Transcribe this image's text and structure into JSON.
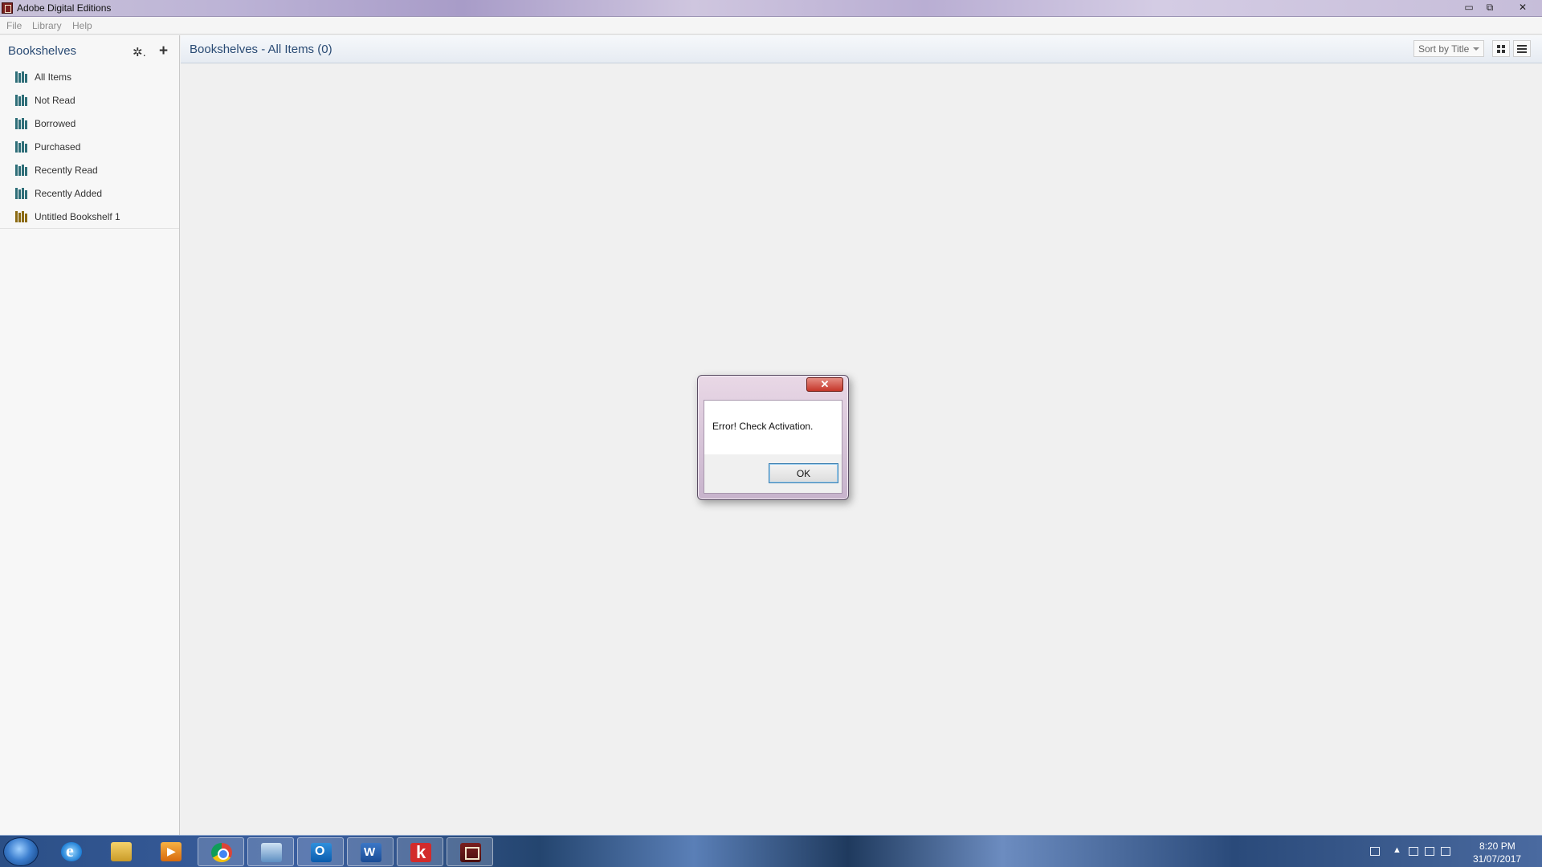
{
  "window": {
    "title": "Adobe Digital Editions"
  },
  "window_controls": {
    "minimize": "▭",
    "maximize": "⧉",
    "close": "✕"
  },
  "menu": [
    "File",
    "Library",
    "Help"
  ],
  "sidebar": {
    "title": "Bookshelves",
    "gear_glyph": "✲.",
    "add_glyph": "+",
    "items": [
      {
        "label": "All Items",
        "icon": "bookshelf-icon"
      },
      {
        "label": "Not Read",
        "icon": "bookshelf-icon"
      },
      {
        "label": "Borrowed",
        "icon": "bookshelf-icon"
      },
      {
        "label": "Purchased",
        "icon": "bookshelf-icon"
      },
      {
        "label": "Recently Read",
        "icon": "bookshelf-icon"
      },
      {
        "label": "Recently Added",
        "icon": "bookshelf-icon"
      },
      {
        "label": "Untitled Bookshelf 1",
        "icon": "custom-bookshelf-icon"
      }
    ]
  },
  "content": {
    "title": "Bookshelves - All Items (0)",
    "sort_label": "Sort by Title"
  },
  "dialog": {
    "close_glyph": "✕",
    "message": "Error! Check Activation.",
    "ok_label": "OK"
  },
  "taskbar": {
    "apps": [
      {
        "name": "internet-explorer-icon"
      },
      {
        "name": "file-explorer-icon"
      },
      {
        "name": "media-player-icon"
      },
      {
        "name": "chrome-icon"
      },
      {
        "name": "remote-desktop-icon"
      },
      {
        "name": "outlook-icon"
      },
      {
        "name": "word-icon"
      },
      {
        "name": "k-app-icon"
      },
      {
        "name": "adobe-digital-editions-icon"
      }
    ],
    "clock": {
      "time": "8:20 PM",
      "date": "31/07/2017"
    }
  },
  "colors": {
    "accent_text": "#2a4b74",
    "shelf_icon": "#2e6e78",
    "custom_shelf_icon": "#8b6a12",
    "dialog_close": "#c5362a"
  }
}
